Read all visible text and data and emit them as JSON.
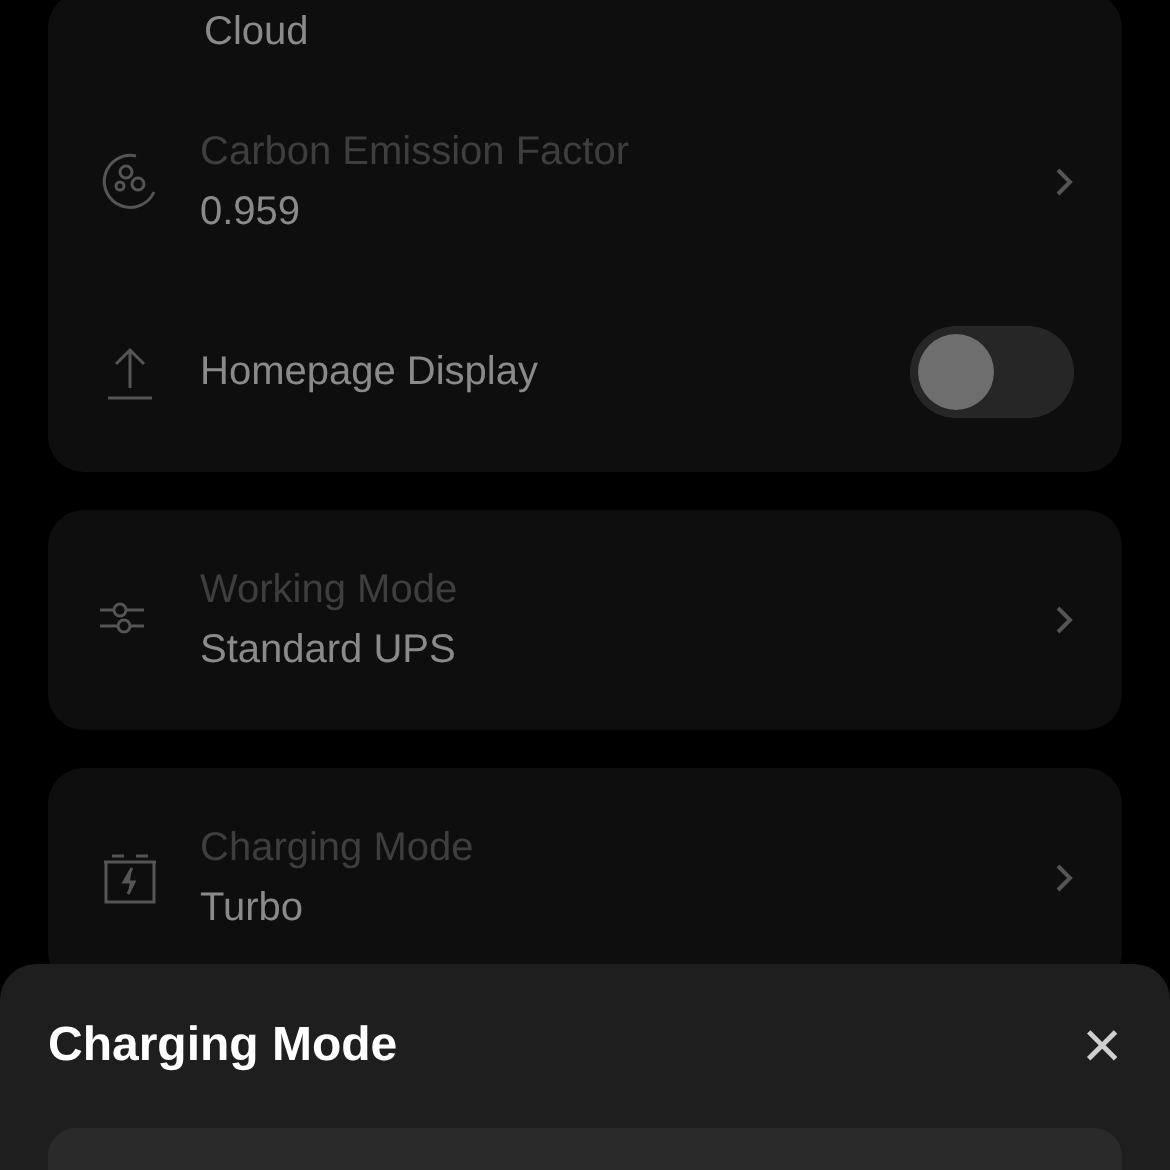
{
  "settings_card": {
    "rows": [
      {
        "kind": "value",
        "value": "Cloud"
      },
      {
        "kind": "link",
        "label": "Carbon Emission Factor",
        "value": "0.959"
      },
      {
        "kind": "toggle",
        "label": "Homepage Display",
        "on": false
      }
    ]
  },
  "working_mode": {
    "kind": "link",
    "label": "Working Mode",
    "value": "Standard UPS"
  },
  "charging_mode": {
    "kind": "link",
    "label": "Charging Mode",
    "value": "Turbo"
  },
  "sheet": {
    "title": "Charging Mode",
    "close": "×"
  }
}
